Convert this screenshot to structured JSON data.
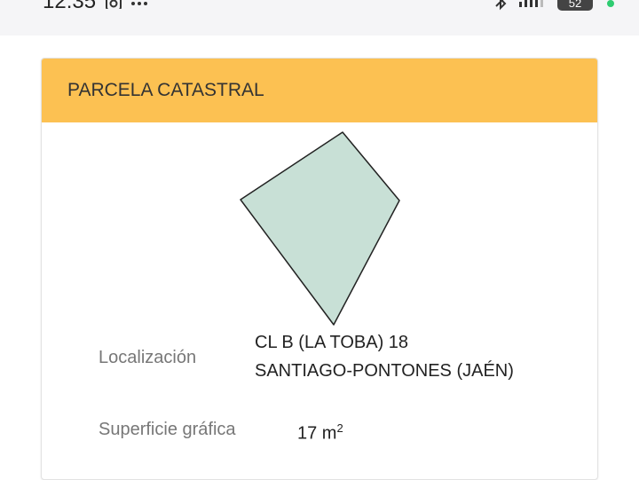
{
  "status_bar": {
    "time": "12:35",
    "battery": "52"
  },
  "card": {
    "title": "PARCELA CATASTRAL",
    "parcel_color": "#c8e0d6",
    "header_color": "#fcc152",
    "location_label": "Localización",
    "location_line1": "CL B (LA TOBA) 18",
    "location_line2": "SANTIAGO-PONTONES (JAÉN)",
    "surface_label": "Superficie gráfica",
    "surface_value": "17 m",
    "surface_exp": "2"
  }
}
